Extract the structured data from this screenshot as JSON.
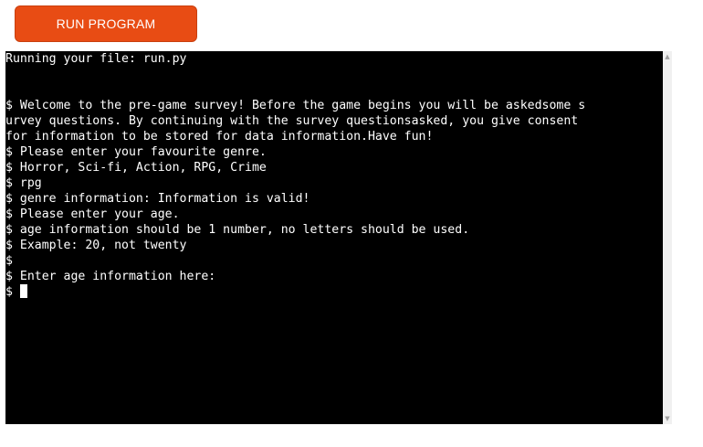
{
  "run_button": {
    "label": "RUN PROGRAM"
  },
  "terminal": {
    "lines": [
      "Running your file: run.py",
      "",
      "",
      "$ Welcome to the pre-game survey! Before the game begins you will be askedsome s",
      "urvey questions. By continuing with the survey questionsasked, you give consent",
      "for information to be stored for data information.Have fun!",
      "$ Please enter your favourite genre.",
      "$ Horror, Sci-fi, Action, RPG, Crime",
      "$ rpg",
      "$ genre information: Information is valid!",
      "$ Please enter your age.",
      "$ age information should be 1 number, no letters should be used.",
      "$ Example: 20, not twenty",
      "$",
      "$ Enter age information here:"
    ],
    "prompt": "$"
  },
  "scrollbar": {
    "up_icon": "triangle-up-icon",
    "down_icon": "triangle-down-icon"
  },
  "colors": {
    "button_bg": "#e84c14",
    "terminal_bg": "#000000",
    "terminal_fg": "#ffffff"
  }
}
